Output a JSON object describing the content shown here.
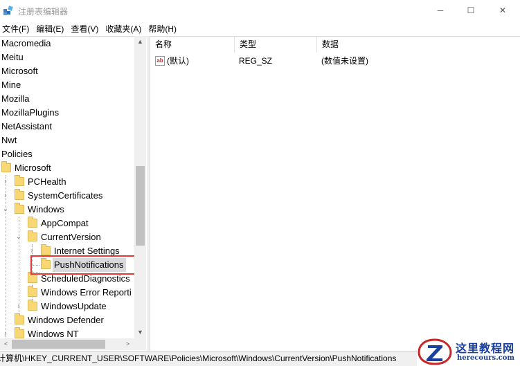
{
  "window": {
    "title": "注册表编辑器",
    "minimize_glyph": "─",
    "maximize_glyph": "☐",
    "close_glyph": "✕"
  },
  "menu": [
    "文件(F)",
    "编辑(E)",
    "查看(V)",
    "收藏夹(A)",
    "帮助(H)"
  ],
  "tree": {
    "items": [
      {
        "label": "Macromedia"
      },
      {
        "label": "Meitu"
      },
      {
        "label": "Microsoft"
      },
      {
        "label": "Mine"
      },
      {
        "label": "Mozilla"
      },
      {
        "label": "MozillaPlugins"
      },
      {
        "label": "NetAssistant"
      },
      {
        "label": "Nwt"
      },
      {
        "label": "Policies"
      },
      {
        "label": "Microsoft"
      },
      {
        "label": "PCHealth"
      },
      {
        "label": "SystemCertificates"
      },
      {
        "label": "Windows"
      },
      {
        "label": "AppCompat"
      },
      {
        "label": "CurrentVersion"
      },
      {
        "label": "Internet Settings"
      },
      {
        "label": "PushNotifications"
      },
      {
        "label": "ScheduledDiagnostics"
      },
      {
        "label": "Windows Error Reporti"
      },
      {
        "label": "WindowsUpdate"
      },
      {
        "label": "Windows Defender"
      },
      {
        "label": "Windows NT"
      }
    ],
    "selected": "PushNotifications",
    "expander_collapsed": "›",
    "expander_expanded": "⌄"
  },
  "scroll": {
    "up": "▲",
    "down": "▼",
    "left": "<",
    "right": ">"
  },
  "list": {
    "columns": [
      "名称",
      "类型",
      "数据"
    ],
    "rows": [
      {
        "icon": "ab",
        "name": "(默认)",
        "type": "REG_SZ",
        "data": "(数值未设置)"
      }
    ]
  },
  "status": {
    "path": "计算机\\HKEY_CURRENT_USER\\SOFTWARE\\Policies\\Microsoft\\Windows\\CurrentVersion\\PushNotifications"
  },
  "watermark": {
    "title": "这里教程网",
    "url": "herecours.com"
  },
  "colors": {
    "folder": "#f8d775",
    "highlight": "#e53935",
    "selection": "#d9d9d9",
    "brand": "#1a3f9c"
  }
}
